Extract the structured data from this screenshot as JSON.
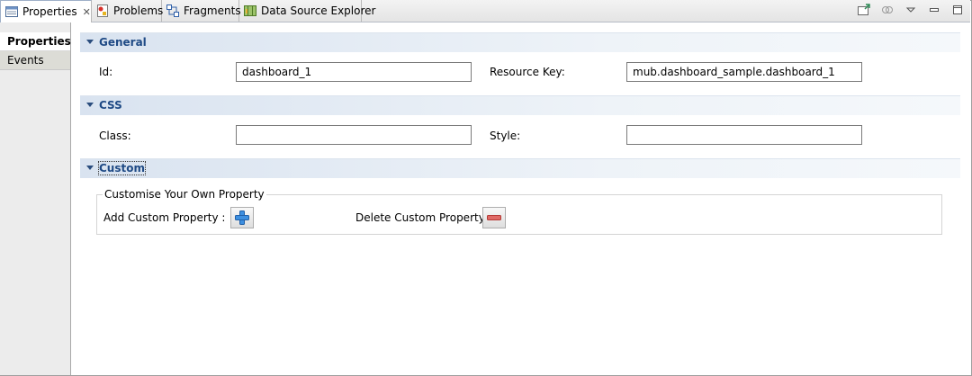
{
  "tabs": [
    {
      "label": "Properties",
      "icon": "properties-icon",
      "active": true,
      "closable": true
    },
    {
      "label": "Problems",
      "icon": "problems-icon",
      "active": false
    },
    {
      "label": "Fragments",
      "icon": "fragments-icon",
      "active": false
    },
    {
      "label": "Data Source Explorer",
      "icon": "data-source-explorer-icon",
      "active": false
    }
  ],
  "toolbar": {
    "buttons": [
      "pin-view-icon",
      "link-icon",
      "view-menu-icon",
      "minimize-icon",
      "maximize-icon"
    ]
  },
  "sidebar": {
    "items": [
      {
        "label": "Properties",
        "active": true
      },
      {
        "label": "Events",
        "active": false
      }
    ]
  },
  "sections": {
    "general": {
      "title": "General",
      "id_label": "Id:",
      "id_value": "dashboard_1",
      "resource_key_label": "Resource Key:",
      "resource_key_value": "mub.dashboard_sample.dashboard_1"
    },
    "css": {
      "title": "CSS",
      "class_label": "Class:",
      "class_value": "",
      "style_label": "Style:",
      "style_value": ""
    },
    "custom": {
      "title": "Custom",
      "group_title": "Customise Your Own Property",
      "add_label": "Add Custom Property :",
      "delete_label": "Delete Custom Property :"
    }
  },
  "colors": {
    "section_title": "#1f4a85",
    "add_icon": "#2f7fd1",
    "delete_icon": "#d9534f"
  }
}
